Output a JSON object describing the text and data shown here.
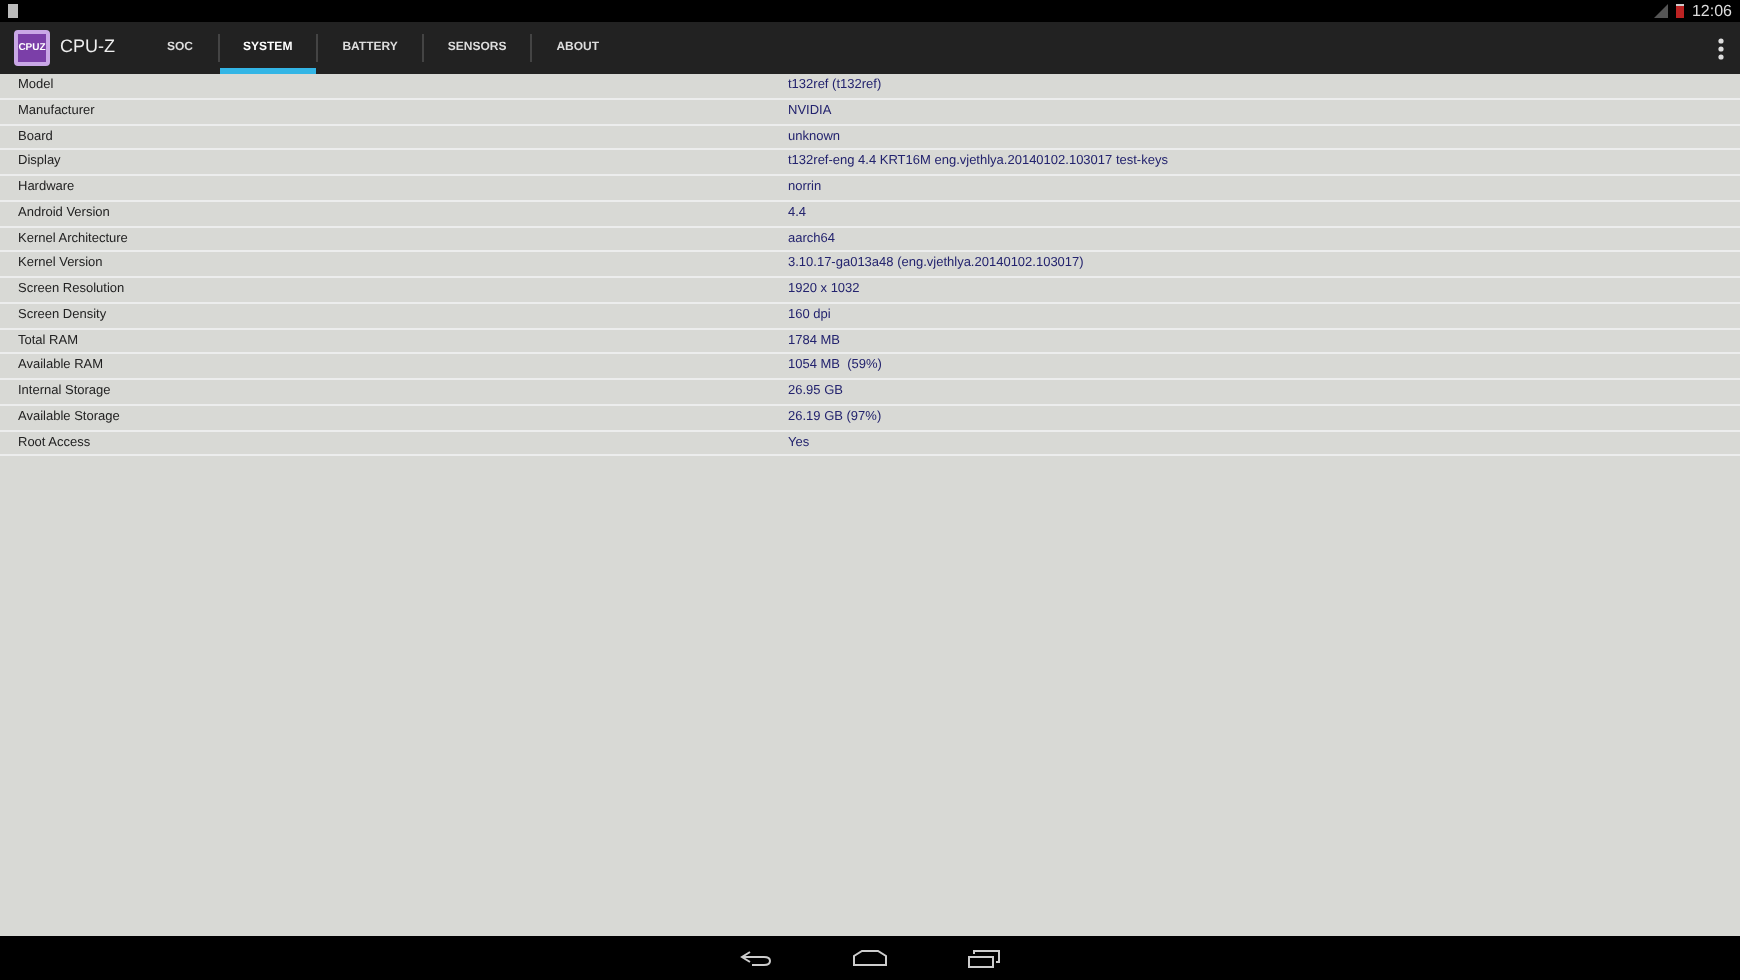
{
  "status_bar": {
    "time": "12:06"
  },
  "app_bar": {
    "logo_text": "CPUZ",
    "title": "CPU-Z",
    "tabs": [
      {
        "label": "SOC",
        "selected": false
      },
      {
        "label": "SYSTEM",
        "selected": true
      },
      {
        "label": "BATTERY",
        "selected": false
      },
      {
        "label": "SENSORS",
        "selected": false
      },
      {
        "label": "ABOUT",
        "selected": false
      }
    ]
  },
  "rows": [
    {
      "label": "Model",
      "value": "t132ref (t132ref)"
    },
    {
      "label": "Manufacturer",
      "value": "NVIDIA"
    },
    {
      "label": "Board",
      "value": "unknown"
    },
    {
      "label": "Display",
      "value": "t132ref-eng 4.4 KRT16M eng.vjethlya.20140102.103017 test-keys"
    },
    {
      "label": "Hardware",
      "value": "norrin"
    },
    {
      "label": "Android Version",
      "value": "4.4"
    },
    {
      "label": "Kernel Architecture",
      "value": "aarch64"
    },
    {
      "label": "Kernel Version",
      "value": "3.10.17-ga013a48 (eng.vjethlya.20140102.103017)"
    },
    {
      "label": "Screen Resolution",
      "value": "1920 x 1032"
    },
    {
      "label": "Screen Density",
      "value": "160 dpi"
    },
    {
      "label": "Total RAM",
      "value": "1784 MB"
    },
    {
      "label": "Available RAM",
      "value": "1054 MB  (59%)"
    },
    {
      "label": "Internal Storage",
      "value": "26.95 GB"
    },
    {
      "label": "Available Storage",
      "value": "26.19 GB (97%)"
    },
    {
      "label": "Root Access",
      "value": "Yes"
    }
  ]
}
